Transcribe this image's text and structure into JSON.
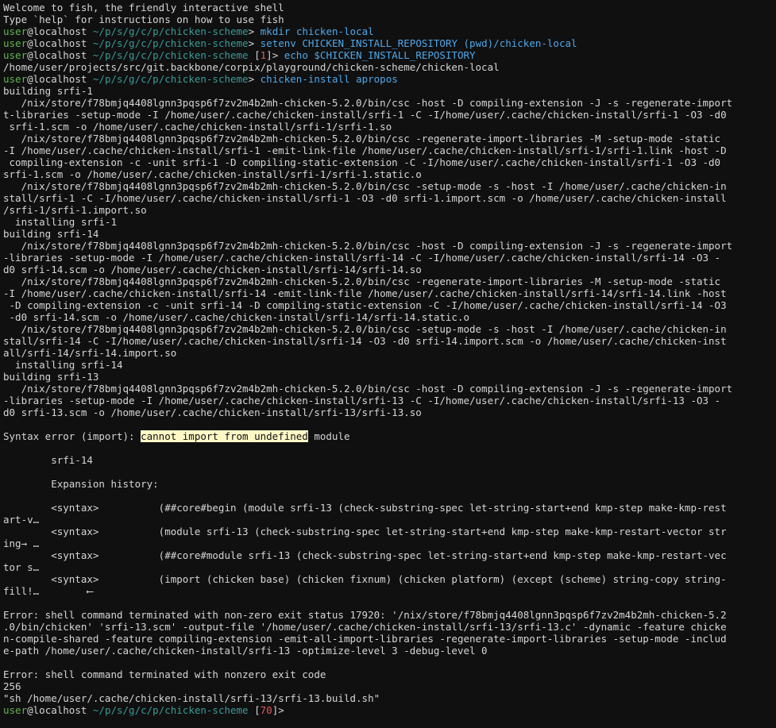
{
  "prompt": {
    "user": "user",
    "at": "@",
    "host": "localhost",
    "path": "~/p/s/g/c/p/chicken-scheme"
  },
  "greeting": [
    "Welcome to fish, the friendly interactive shell",
    "Type `help` for instructions on how to use fish"
  ],
  "commands": {
    "c1": {
      "cmd": "mkdir",
      "args": "chicken-local"
    },
    "c2": {
      "cmd": "setenv",
      "args": "CHICKEN_INSTALL_REPOSITORY",
      "paren": "(pwd)",
      "tail": "/chicken-local"
    },
    "c3": {
      "status": "1",
      "cmd": "echo",
      "var": "$CHICKEN_INSTALL_REPOSITORY"
    },
    "c4": {
      "cmd": "chicken-install",
      "args": "apropos"
    }
  },
  "output": {
    "o1": "/home/user/projects/src/git.backbone/corpix/playground/chicken-scheme/chicken-local",
    "l01": "building srfi-1",
    "l02": "   /nix/store/f78bmjq4408lgnn3pqsp6f7zv2m4b2mh-chicken-5.2.0/bin/csc -host -D compiling-extension -J -s -regenerate-import",
    "l03": "t-libraries -setup-mode -I /home/user/.cache/chicken-install/srfi-1 -C -I/home/user/.cache/chicken-install/srfi-1 -O3 -d0",
    "l04": " srfi-1.scm -o /home/user/.cache/chicken-install/srfi-1/srfi-1.so",
    "l05": "   /nix/store/f78bmjq4408lgnn3pqsp6f7zv2m4b2mh-chicken-5.2.0/bin/csc -regenerate-import-libraries -M -setup-mode -static",
    "l06": "-I /home/user/.cache/chicken-install/srfi-1 -emit-link-file /home/user/.cache/chicken-install/srfi-1/srfi-1.link -host -D",
    "l07": " compiling-extension -c -unit srfi-1 -D compiling-static-extension -C -I/home/user/.cache/chicken-install/srfi-1 -O3 -d0",
    "l08": "srfi-1.scm -o /home/user/.cache/chicken-install/srfi-1/srfi-1.static.o",
    "l09": "   /nix/store/f78bmjq4408lgnn3pqsp6f7zv2m4b2mh-chicken-5.2.0/bin/csc -setup-mode -s -host -I /home/user/.cache/chicken-in",
    "l10": "stall/srfi-1 -C -I/home/user/.cache/chicken-install/srfi-1 -O3 -d0 srfi-1.import.scm -o /home/user/.cache/chicken-install",
    "l11": "/srfi-1/srfi-1.import.so",
    "l12": "  installing srfi-1",
    "l13": "building srfi-14",
    "l14": "   /nix/store/f78bmjq4408lgnn3pqsp6f7zv2m4b2mh-chicken-5.2.0/bin/csc -host -D compiling-extension -J -s -regenerate-import",
    "l15": "-libraries -setup-mode -I /home/user/.cache/chicken-install/srfi-14 -C -I/home/user/.cache/chicken-install/srfi-14 -O3 -",
    "l16": "d0 srfi-14.scm -o /home/user/.cache/chicken-install/srfi-14/srfi-14.so",
    "l17": "   /nix/store/f78bmjq4408lgnn3pqsp6f7zv2m4b2mh-chicken-5.2.0/bin/csc -regenerate-import-libraries -M -setup-mode -static",
    "l18": "-I /home/user/.cache/chicken-install/srfi-14 -emit-link-file /home/user/.cache/chicken-install/srfi-14/srfi-14.link -host",
    "l19": " -D compiling-extension -c -unit srfi-14 -D compiling-static-extension -C -I/home/user/.cache/chicken-install/srfi-14 -O3",
    "l20": " -d0 srfi-14.scm -o /home/user/.cache/chicken-install/srfi-14/srfi-14.static.o",
    "l21": "   /nix/store/f78bmjq4408lgnn3pqsp6f7zv2m4b2mh-chicken-5.2.0/bin/csc -setup-mode -s -host -I /home/user/.cache/chicken-in",
    "l22": "stall/srfi-14 -C -I/home/user/.cache/chicken-install/srfi-14 -O3 -d0 srfi-14.import.scm -o /home/user/.cache/chicken-inst",
    "l23": "all/srfi-14/srfi-14.import.so",
    "l24": "  installing srfi-14",
    "l25": "building srfi-13",
    "l26": "   /nix/store/f78bmjq4408lgnn3pqsp6f7zv2m4b2mh-chicken-5.2.0/bin/csc -host -D compiling-extension -J -s -regenerate-import",
    "l27": "-libraries -setup-mode -I /home/user/.cache/chicken-install/srfi-13 -C -I/home/user/.cache/chicken-install/srfi-13 -O3 -",
    "l28": "d0 srfi-13.scm -o /home/user/.cache/chicken-install/srfi-13/srfi-13.so"
  },
  "error": {
    "syntax_prefix": "Syntax error (import): ",
    "syntax_highlight": "cannot import from undefined",
    "syntax_suffix": " module",
    "module": "        srfi-14",
    "history_title": "        Expansion history:",
    "h1a": "        <syntax>          (##core#begin (module srfi-13 (check-substring-spec let-string-start+end kmp-step make-kmp-rest",
    "h1b": "art-v…",
    "h2a": "        <syntax>          (module srfi-13 (check-substring-spec let-string-start+end kmp-step make-kmp-restart-vector str",
    "h2b": "ing→ …",
    "h3a": "        <syntax>          (##core#module srfi-13 (check-substring-spec let-string-start+end kmp-step make-kmp-restart-vec",
    "h3b": "tor s…",
    "h4a": "        <syntax>          (import (chicken base) (chicken fixnum) (chicken platform) (except (scheme) string-copy string-",
    "h4b": "fill!…        ⟵",
    "e1": "Error: shell command terminated with non-zero exit status 17920: '/nix/store/f78bmjq4408lgnn3pqsp6f7zv2m4b2mh-chicken-5.2",
    "e2": ".0/bin/chicken' 'srfi-13.scm' -output-file '/home/user/.cache/chicken-install/srfi-13/srfi-13.c' -dynamic -feature chicke",
    "e3": "n-compile-shared -feature compiling-extension -emit-all-import-libraries -regenerate-import-libraries -setup-mode -includ",
    "e4": "e-path /home/user/.cache/chicken-install/srfi-13 -optimize-level 3 -debug-level 0",
    "e5": "Error: shell command terminated with nonzero exit code",
    "e6": "256",
    "e7": "\"sh /home/user/.cache/chicken-install/srfi-13/srfi-13.build.sh\""
  },
  "final_prompt": {
    "status": "70",
    "suffix": ">"
  },
  "colors": {
    "background": "#101010",
    "foreground": "#d6d6d6",
    "user": "#64b450",
    "path": "#3b9a9a",
    "command": "#4fa8ea",
    "status": "#e05a5a",
    "highlight": "#fff8c6"
  }
}
